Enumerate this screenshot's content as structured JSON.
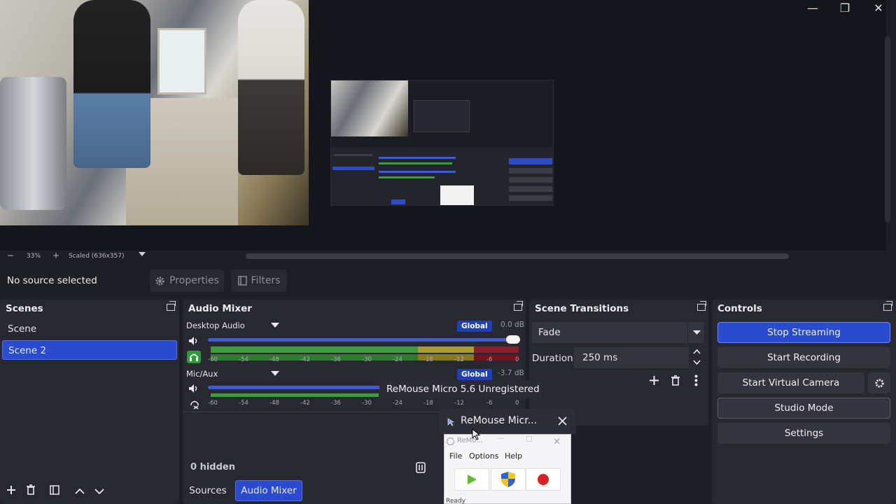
{
  "preview": {
    "zoom_minus": "−",
    "zoom_level": "33%",
    "zoom_plus": "+",
    "scale_mode": "Scaled (636x357)"
  },
  "window": {
    "minimize": "—",
    "restore": "❐",
    "close": "✕"
  },
  "source_toolbar": {
    "status": "No source selected",
    "properties_label": "Properties",
    "filters_label": "Filters"
  },
  "scenes": {
    "title": "Scenes",
    "items": [
      {
        "label": "Scene",
        "selected": false
      },
      {
        "label": "Scene 2",
        "selected": true
      }
    ]
  },
  "audio_mixer": {
    "title": "Audio Mixer",
    "global_label": "Global",
    "channels": [
      {
        "name": "Desktop Audio",
        "db": "0.0 dB",
        "volume": 1.0
      },
      {
        "name": "Mic/Aux",
        "db": "-3.7 dB",
        "volume": 0.85
      }
    ],
    "ticks": [
      "-60",
      "-54",
      "-48",
      "-42",
      "-36",
      "-30",
      "-24",
      "-18",
      "-12",
      "-6",
      "0"
    ],
    "hidden_label": "0 hidden"
  },
  "bottom_tabs": {
    "sources": "Sources",
    "audio_mixer": "Audio Mixer"
  },
  "scene_transitions": {
    "title": "Scene Transitions",
    "transition": "Fade",
    "duration_label": "Duration",
    "duration_value": "250 ms"
  },
  "controls": {
    "title": "Controls",
    "stop_streaming": "Stop Streaming",
    "start_recording": "Start Recording",
    "start_virtual_camera": "Start Virtual Camera",
    "studio_mode": "Studio Mode",
    "settings": "Settings"
  },
  "tooltip": {
    "text": "ReMouse Micro 5.6 Unregistered"
  },
  "remouse": {
    "title": "ReMouse Micr...",
    "inner_title": "ReMo...",
    "menu": [
      "File",
      "Options",
      "Help"
    ],
    "status": "Ready"
  },
  "colors": {
    "accent": "#2a4bd0",
    "meter_green": "#3e9a3e",
    "meter_yellow": "#a89c2a",
    "meter_red": "#8a1e2c"
  }
}
